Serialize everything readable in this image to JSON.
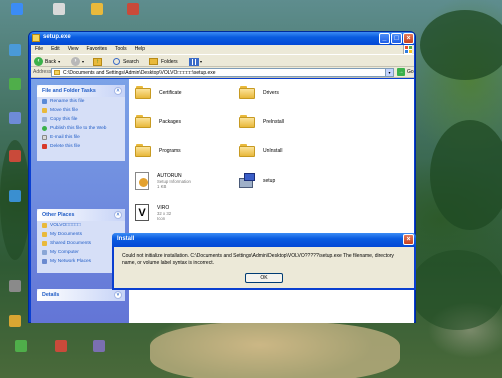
{
  "desktop": {
    "icons": [
      {
        "label": "",
        "color": "#3b8cf5"
      },
      {
        "label": "",
        "color": "#d9d9d9"
      },
      {
        "label": "",
        "color": "#e9b93b"
      },
      {
        "label": "",
        "color": "#c94a3a"
      },
      {
        "label": "",
        "color": "#4a9ad8"
      },
      {
        "label": "",
        "color": "#4fae4a"
      },
      {
        "label": "",
        "color": "#6e8bd8"
      },
      {
        "label": "",
        "color": "#c94a3a"
      },
      {
        "label": "",
        "color": "#3a8fd0"
      },
      {
        "label": "",
        "color": "#8a8a8a"
      },
      {
        "label": "",
        "color": "#d9a632"
      },
      {
        "label": "",
        "color": "#c94a3a"
      },
      {
        "label": "",
        "color": "#7a6fb0"
      },
      {
        "label": "",
        "color": "#4fae4a"
      }
    ]
  },
  "window": {
    "title": "setup.exe",
    "menu": [
      "File",
      "Edit",
      "View",
      "Favorites",
      "Tools",
      "Help"
    ],
    "toolbar": {
      "back": "Back",
      "search": "Search",
      "folders": "Folders"
    },
    "address_label": "Address",
    "address_value": "C:\\Documents and Settings\\Admin\\Desktop\\VOLVO□□□□□\\setup.exe",
    "go_label": "Go",
    "tasks": {
      "title": "File and Folder Tasks",
      "items": [
        "Rename this file",
        "Move this file",
        "Copy this file",
        "Publish this file to the Web",
        "E-mail this file",
        "Delete this file"
      ]
    },
    "other_places": {
      "title": "Other Places",
      "items": [
        "VOLVO□□□□□",
        "My Documents",
        "Shared Documents",
        "My Computer",
        "My Network Places"
      ]
    },
    "details": {
      "title": "Details"
    },
    "files": [
      {
        "name": "Certificate",
        "type": "folder"
      },
      {
        "name": "Drivers",
        "type": "folder"
      },
      {
        "name": "Packages",
        "type": "folder"
      },
      {
        "name": "PreInstall",
        "type": "folder"
      },
      {
        "name": "Programs",
        "type": "folder"
      },
      {
        "name": "UnInstall",
        "type": "folder"
      },
      {
        "name": "AUTORUN",
        "type": "setup-info",
        "meta1": "Setup Information",
        "meta2": "1 KB"
      },
      {
        "name": "setup",
        "type": "exe"
      },
      {
        "name": "VIRO",
        "type": "icon-file",
        "meta1": "32 x 32",
        "meta2": "Icon"
      }
    ]
  },
  "dialog": {
    "title": "Install",
    "message": "Could not initialize installation. C:\\Documents and Settings\\Admin\\Desktop\\VOLVO?????\\setup.exe The filename, directory name, or volume label syntax is incorrect.",
    "ok_label": "OK"
  }
}
